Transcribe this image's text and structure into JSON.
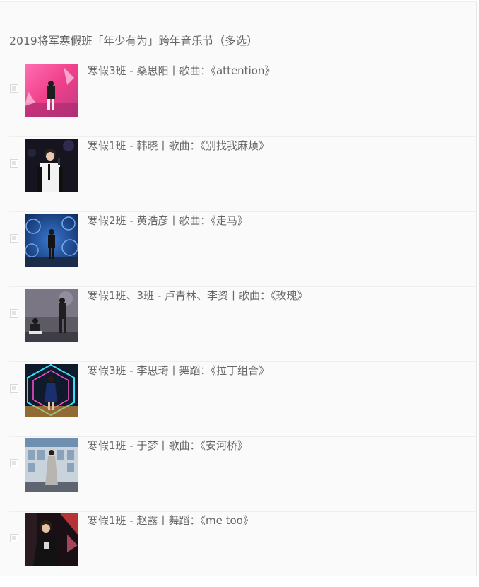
{
  "question": {
    "title": "2019将军寒假班「年少有为」跨年音乐节（多选）"
  },
  "options": [
    {
      "label": "寒假3班 - 桑思阳丨歌曲：《attention》",
      "checked": false,
      "photo": "performer-photo-pink-stage"
    },
    {
      "label": "寒假1班 - 韩晓丨歌曲：《别找我麻烦》",
      "checked": false,
      "photo": "performer-photo-dark-stage"
    },
    {
      "label": "寒假2班 - 黄浩彦丨歌曲：《走马》",
      "checked": false,
      "photo": "performer-photo-blue-bubbles"
    },
    {
      "label": "寒假1班、3班 - 卢青林、李资丨歌曲：《玫瑰》",
      "checked": false,
      "photo": "performer-photo-duo-stage"
    },
    {
      "label": "寒假3班 - 李思琦丨舞蹈：《拉丁组合》",
      "checked": false,
      "photo": "performer-photo-neon-hexagon"
    },
    {
      "label": "寒假1班 - 于梦丨歌曲：《安河桥》",
      "checked": false,
      "photo": "performer-photo-building-backdrop"
    },
    {
      "label": "寒假1班 - 赵露丨舞蹈：《me too》",
      "checked": false,
      "photo": "performer-photo-dark-red-stage"
    }
  ]
}
